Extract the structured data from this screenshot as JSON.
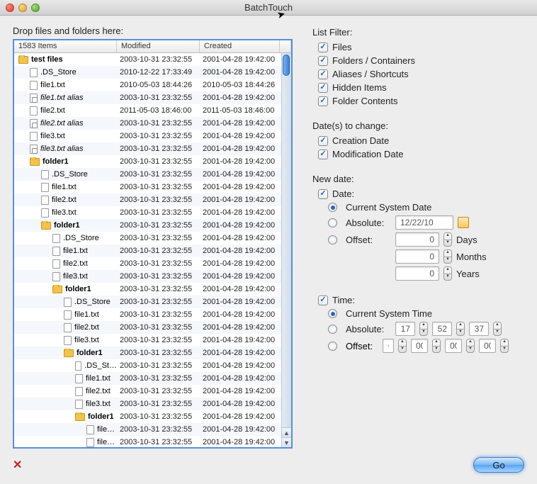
{
  "window": {
    "title": "BatchTouch"
  },
  "drop_label": "Drop files and folders here:",
  "table": {
    "item_count": "1583 Items",
    "col_modified": "Modified",
    "col_created": "Created",
    "rows": [
      {
        "indent": 0,
        "icon": "folder",
        "bold": true,
        "name": "test files",
        "mod": "2003-10-31 23:32:55",
        "cre": "2001-04-28 19:42:00"
      },
      {
        "indent": 1,
        "icon": "file",
        "name": ".DS_Store",
        "mod": "2010-12-22 17:33:49",
        "cre": "2001-04-28 19:42:00"
      },
      {
        "indent": 1,
        "icon": "file",
        "name": "file1.txt",
        "mod": "2010-05-03 18:44:26",
        "cre": "2010-05-03 18:44:26"
      },
      {
        "indent": 1,
        "icon": "alias",
        "italic": true,
        "name": "file1.txt alias",
        "mod": "2003-10-31 23:32:55",
        "cre": "2001-04-28 19:42:00"
      },
      {
        "indent": 1,
        "icon": "file",
        "name": "file2.txt",
        "mod": "2011-05-03 18:46:00",
        "cre": "2011-05-03 18:46:00"
      },
      {
        "indent": 1,
        "icon": "alias",
        "italic": true,
        "name": "file2.txt alias",
        "mod": "2003-10-31 23:32:55",
        "cre": "2001-04-28 19:42:00"
      },
      {
        "indent": 1,
        "icon": "file",
        "name": "file3.txt",
        "mod": "2003-10-31 23:32:55",
        "cre": "2001-04-28 19:42:00"
      },
      {
        "indent": 1,
        "icon": "alias",
        "italic": true,
        "name": "file3.txt alias",
        "mod": "2003-10-31 23:32:55",
        "cre": "2001-04-28 19:42:00"
      },
      {
        "indent": 1,
        "icon": "folder",
        "bold": true,
        "name": "folder1",
        "mod": "2003-10-31 23:32:55",
        "cre": "2001-04-28 19:42:00"
      },
      {
        "indent": 2,
        "icon": "file",
        "name": ".DS_Store",
        "mod": "2003-10-31 23:32:55",
        "cre": "2001-04-28 19:42:00"
      },
      {
        "indent": 2,
        "icon": "file",
        "name": "file1.txt",
        "mod": "2003-10-31 23:32:55",
        "cre": "2001-04-28 19:42:00"
      },
      {
        "indent": 2,
        "icon": "file",
        "name": "file2.txt",
        "mod": "2003-10-31 23:32:55",
        "cre": "2001-04-28 19:42:00"
      },
      {
        "indent": 2,
        "icon": "file",
        "name": "file3.txt",
        "mod": "2003-10-31 23:32:55",
        "cre": "2001-04-28 19:42:00"
      },
      {
        "indent": 2,
        "icon": "folder",
        "bold": true,
        "name": "folder1",
        "mod": "2003-10-31 23:32:55",
        "cre": "2001-04-28 19:42:00"
      },
      {
        "indent": 3,
        "icon": "file",
        "name": ".DS_Store",
        "mod": "2003-10-31 23:32:55",
        "cre": "2001-04-28 19:42:00"
      },
      {
        "indent": 3,
        "icon": "file",
        "name": "file1.txt",
        "mod": "2003-10-31 23:32:55",
        "cre": "2001-04-28 19:42:00"
      },
      {
        "indent": 3,
        "icon": "file",
        "name": "file2.txt",
        "mod": "2003-10-31 23:32:55",
        "cre": "2001-04-28 19:42:00"
      },
      {
        "indent": 3,
        "icon": "file",
        "name": "file3.txt",
        "mod": "2003-10-31 23:32:55",
        "cre": "2001-04-28 19:42:00"
      },
      {
        "indent": 3,
        "icon": "folder",
        "bold": true,
        "name": "folder1",
        "mod": "2003-10-31 23:32:55",
        "cre": "2001-04-28 19:42:00"
      },
      {
        "indent": 4,
        "icon": "file",
        "name": ".DS_Store",
        "mod": "2003-10-31 23:32:55",
        "cre": "2001-04-28 19:42:00"
      },
      {
        "indent": 4,
        "icon": "file",
        "name": "file1.txt",
        "mod": "2003-10-31 23:32:55",
        "cre": "2001-04-28 19:42:00"
      },
      {
        "indent": 4,
        "icon": "file",
        "name": "file2.txt",
        "mod": "2003-10-31 23:32:55",
        "cre": "2001-04-28 19:42:00"
      },
      {
        "indent": 4,
        "icon": "file",
        "name": "file3.txt",
        "mod": "2003-10-31 23:32:55",
        "cre": "2001-04-28 19:42:00"
      },
      {
        "indent": 4,
        "icon": "folder",
        "bold": true,
        "name": "folder1",
        "mod": "2003-10-31 23:32:55",
        "cre": "2001-04-28 19:42:00"
      },
      {
        "indent": 5,
        "icon": "file",
        "name": ".DS_St…",
        "mod": "2003-10-31 23:32:55",
        "cre": "2001-04-28 19:42:00"
      },
      {
        "indent": 5,
        "icon": "file",
        "name": "file1.txt",
        "mod": "2003-10-31 23:32:55",
        "cre": "2001-04-28 19:42:00"
      },
      {
        "indent": 5,
        "icon": "file",
        "name": "file2.txt",
        "mod": "2003-10-31 23:32:55",
        "cre": "2001-04-28 19:42:00"
      },
      {
        "indent": 5,
        "icon": "file",
        "name": "file3.txt",
        "mod": "2003-10-31 23:32:55",
        "cre": "2001-04-28 19:42:00"
      },
      {
        "indent": 5,
        "icon": "folder",
        "bold": true,
        "name": "folder1",
        "mod": "2003-10-31 23:32:55",
        "cre": "2001-04-28 19:42:00"
      },
      {
        "indent": 6,
        "icon": "file",
        "name": "file…",
        "mod": "2003-10-31 23:32:55",
        "cre": "2001-04-28 19:42:00"
      },
      {
        "indent": 6,
        "icon": "file",
        "name": "file…",
        "mod": "2003-10-31 23:32:55",
        "cre": "2001-04-28 19:42:00"
      }
    ]
  },
  "list_filter": {
    "title": "List Filter:",
    "files": "Files",
    "folders": "Folders / Containers",
    "aliases": "Aliases / Shortcuts",
    "hidden": "Hidden Items",
    "contents": "Folder Contents"
  },
  "dates_change": {
    "title": "Date(s) to change:",
    "creation": "Creation Date",
    "modification": "Modification Date"
  },
  "new_date": {
    "title": "New date:",
    "date_label": "Date:",
    "date_current": "Current System Date",
    "date_absolute": "Absolute:",
    "date_absolute_value": "12/22/10",
    "date_offset": "Offset:",
    "offset_days": "0",
    "unit_days": "Days",
    "offset_months": "0",
    "unit_months": "Months",
    "offset_years": "0",
    "unit_years": "Years",
    "time_label": "Time:",
    "time_current": "Current System Time",
    "time_absolute": "Absolute:",
    "time_h": "17",
    "time_m": "52",
    "time_s": "37",
    "time_offset": "Offset:",
    "time_offset_sign": "+",
    "time_oh": "00",
    "time_om": "00",
    "time_os": "00"
  },
  "go_label": "Go",
  "delete_label": "✕"
}
